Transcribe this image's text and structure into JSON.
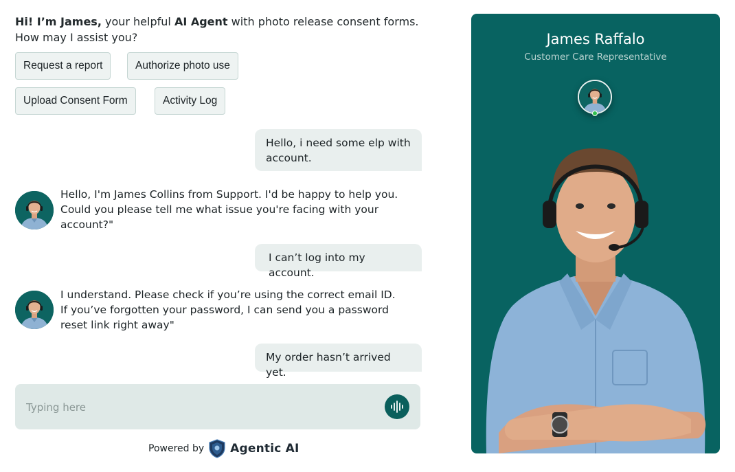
{
  "greeting": {
    "hi": "Hi! I’m James,",
    "part1": " your helpful ",
    "agent_word": "AI Agent",
    "part2": " with photo release consent forms. How may I assist you?"
  },
  "quick_actions": [
    "Request a report",
    "Authorize photo use",
    "Upload Consent Form",
    "Activity Log"
  ],
  "messages": [
    {
      "from": "user",
      "text": "Hello, i need some  elp with account."
    },
    {
      "from": "agent",
      "text": "Hello, I'm James Collins from Support. I'd be happy to help you. Could you please tell me what issue you're facing with your account?\""
    },
    {
      "from": "user",
      "text": "I can’t log into my account."
    },
    {
      "from": "agent",
      "text": "I understand. Please check if you’re using the correct email ID. If you’ve forgotten your password, I can send you a password reset link right away\""
    },
    {
      "from": "user",
      "text": "My order hasn’t arrived yet."
    }
  ],
  "composer": {
    "placeholder": "Typing here",
    "mic_icon": "voice-wave-icon"
  },
  "footer": {
    "powered_by": "Powered by",
    "brand": "Agentic AI",
    "brand_icon": "shield-logo-icon"
  },
  "agent_panel": {
    "name": "James Raffalo",
    "role": "Customer Care Representative",
    "status": "online",
    "status_color": "#2fbf4f"
  },
  "colors": {
    "brand_teal": "#086361",
    "user_bubble": "#e9efee",
    "composer_bg": "#dfe9e7",
    "quick_btn_bg": "#eef3f2"
  }
}
